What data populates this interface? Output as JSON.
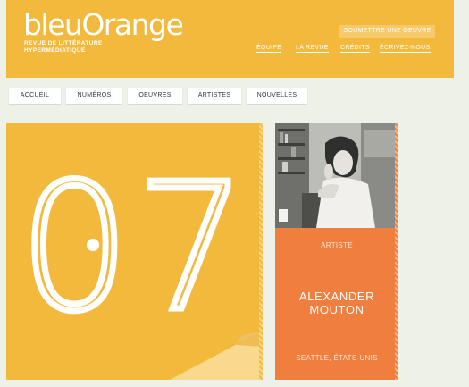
{
  "header": {
    "logo": "bleuOrange",
    "tagline_line1": "REVUE DE LITTÉRATURE",
    "tagline_line2": "HYPERMÉDIATIQUE",
    "submit_label": "SOUMETTRE UNE OEUVRE",
    "links": [
      "ÉQUIPE",
      "LA REVUE",
      "CRÉDITS",
      "ÉCRIVEZ-NOUS"
    ]
  },
  "nav": {
    "tabs": [
      "ACCUEIL",
      "NUMÉROS",
      "OEUVRES",
      "ARTISTES",
      "NOUVELLES"
    ]
  },
  "issue": {
    "number": "07"
  },
  "artist": {
    "role": "ARTISTE",
    "name_line1": "ALEXANDER",
    "name_line2": "MOUTON",
    "location": "SEATTLE, ÉTATS-UNIS"
  },
  "colors": {
    "yellow": "#f3b93c",
    "orange": "#f07e3e",
    "background": "#eef1e7"
  },
  "icons": {
    "photo": "artist-portrait-photo"
  }
}
